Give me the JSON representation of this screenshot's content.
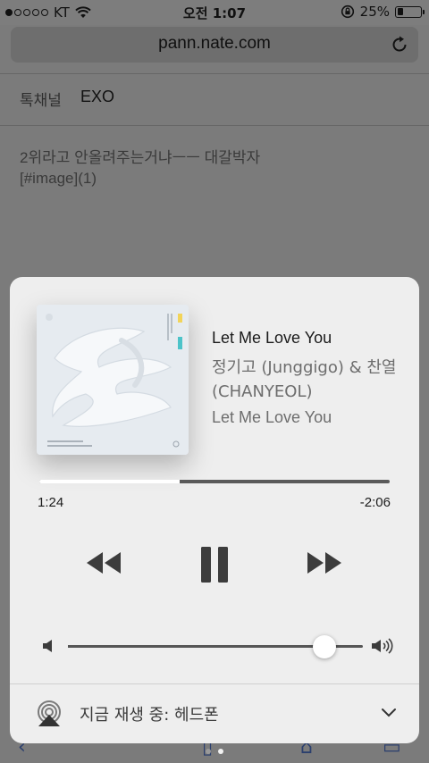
{
  "status_bar": {
    "carrier": "KT",
    "time": "오전 1:07",
    "battery_text": "25%",
    "battery_level": 0.25,
    "icons": [
      "signal-dots",
      "wifi-icon",
      "rotation-lock-icon",
      "battery-icon"
    ]
  },
  "browser": {
    "url": "pann.nate.com",
    "reload_icon": "reload-icon"
  },
  "page": {
    "board_label": "톡채널",
    "board_name": "EXO",
    "post_lines": [
      "2위라고 안올려주는거냐ㅡㅡ 대갈박자",
      "[#image](1)"
    ]
  },
  "now_playing": {
    "title": "Let Me Love You",
    "artist": "정기고 (Junggigo) & 찬열 (CHANYEOL)",
    "album": "Let Me Love You",
    "elapsed": "1:24",
    "remaining": "-2:06",
    "progress": 0.4,
    "volume": 0.87,
    "output_label": "지금 재생 중: 헤드폰",
    "controls": [
      "rewind-icon",
      "pause-icon",
      "fast-forward-icon"
    ]
  },
  "colors": {
    "dim_background": "#7b7b7b",
    "card": "#eeeeee",
    "accent_teal": "#4cc3c9",
    "accent_yellow": "#f2d45a"
  }
}
